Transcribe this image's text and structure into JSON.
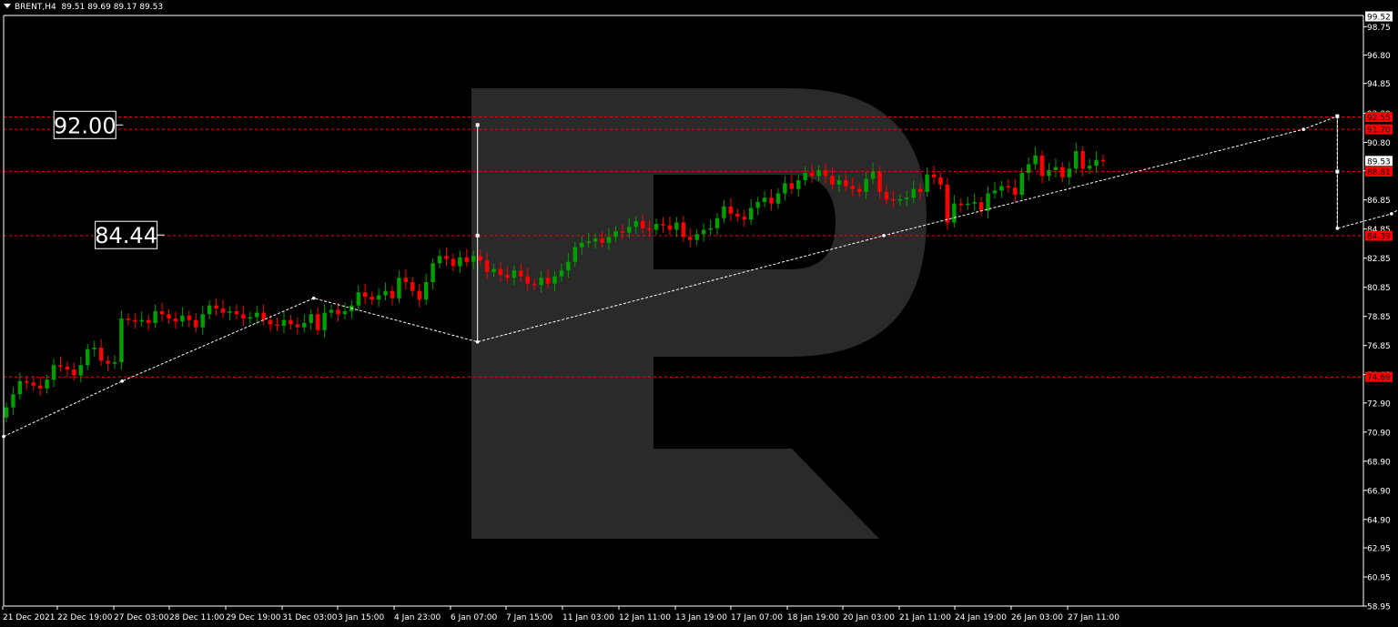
{
  "header": {
    "symbol": "BRENT,H4",
    "ohlc": "89.51 89.69 89.17 89.53"
  },
  "colors": {
    "background": "#000000",
    "bull": "#00a000",
    "bear": "#ff0000",
    "axis": "#ffffff",
    "level_line": "#ff0000",
    "forecast": "#ffffff",
    "watermark": "#2a2a2a"
  },
  "chart_data": {
    "type": "candlestick",
    "ylim": [
      58.95,
      99.52
    ],
    "y_ticks": [
      "98.75",
      "96.80",
      "94.85",
      "92.80",
      "90.80",
      "88.85",
      "86.85",
      "84.85",
      "82.85",
      "80.85",
      "78.85",
      "76.85",
      "74.85",
      "72.90",
      "70.90",
      "68.90",
      "66.90",
      "64.90",
      "62.95",
      "60.95",
      "58.95"
    ],
    "x_tick_labels": [
      "21 Dec 2021",
      "22 Dec 19:00",
      "27 Dec 03:00",
      "28 Dec 11:00",
      "29 Dec 19:00",
      "31 Dec 03:00",
      "3 Jan 15:00",
      "4 Jan 23:00",
      "6 Jan 07:00",
      "7 Jan 15:00",
      "11 Jan 03:00",
      "12 Jan 11:00",
      "13 Jan 19:00",
      "17 Jan 07:00",
      "18 Jan 19:00",
      "20 Jan 03:00",
      "21 Jan 11:00",
      "24 Jan 19:00",
      "26 Jan 03:00",
      "27 Jan 11:00"
    ],
    "current_price": "89.53",
    "top_price": "99.52",
    "levels": [
      {
        "label": "92.55",
        "value": 92.55
      },
      {
        "label": "91.70",
        "value": 91.7
      },
      {
        "label": "88.81",
        "value": 88.81
      },
      {
        "label": "84.39",
        "value": 84.39
      },
      {
        "label": "74.69",
        "value": 74.69
      }
    ],
    "annotations": [
      {
        "label": "92.00",
        "x": 4.2,
        "y": 92.0
      },
      {
        "label": "84.44",
        "x": 10.3,
        "y": 84.44
      }
    ],
    "candles": [
      [
        71.9,
        72.6
      ],
      [
        72.6,
        73.5
      ],
      [
        73.5,
        74.4
      ],
      [
        74.4,
        74.3
      ],
      [
        74.3,
        74.1
      ],
      [
        74.1,
        73.9
      ],
      [
        73.9,
        74.5
      ],
      [
        74.5,
        75.5
      ],
      [
        75.5,
        75.4
      ],
      [
        75.4,
        75.2
      ],
      [
        75.2,
        74.8
      ],
      [
        74.8,
        75.5
      ],
      [
        75.5,
        76.6
      ],
      [
        76.6,
        76.7
      ],
      [
        76.7,
        75.8
      ],
      [
        75.8,
        75.6
      ],
      [
        75.6,
        75.7
      ],
      [
        75.7,
        78.7
      ],
      [
        78.7,
        78.6
      ],
      [
        78.6,
        78.5
      ],
      [
        78.5,
        78.6
      ],
      [
        78.6,
        78.4
      ],
      [
        78.4,
        79.2
      ],
      [
        79.2,
        79.0
      ],
      [
        79.0,
        78.7
      ],
      [
        78.7,
        78.5
      ],
      [
        78.5,
        78.9
      ],
      [
        78.9,
        78.6
      ],
      [
        78.6,
        78.1
      ],
      [
        78.1,
        79.0
      ],
      [
        79.0,
        79.6
      ],
      [
        79.6,
        79.4
      ],
      [
        79.4,
        79.1
      ],
      [
        79.1,
        79.2
      ],
      [
        79.2,
        79.0
      ],
      [
        79.0,
        78.7
      ],
      [
        78.7,
        78.8
      ],
      [
        78.8,
        79.1
      ],
      [
        79.1,
        78.6
      ],
      [
        78.6,
        78.3
      ],
      [
        78.3,
        78.2
      ],
      [
        78.2,
        78.6
      ],
      [
        78.6,
        78.3
      ],
      [
        78.3,
        78.1
      ],
      [
        78.1,
        78.4
      ],
      [
        78.4,
        79.0
      ],
      [
        79.0,
        77.9
      ],
      [
        77.9,
        79.1
      ],
      [
        79.1,
        79.3
      ],
      [
        79.3,
        79.0
      ],
      [
        79.0,
        79.2
      ],
      [
        79.2,
        79.6
      ],
      [
        79.6,
        80.5
      ],
      [
        80.5,
        80.2
      ],
      [
        80.2,
        80.0
      ],
      [
        80.0,
        80.3
      ],
      [
        80.3,
        80.6
      ],
      [
        80.6,
        80.1
      ],
      [
        80.1,
        81.5
      ],
      [
        81.5,
        81.2
      ],
      [
        81.2,
        80.6
      ],
      [
        80.6,
        80.0
      ],
      [
        80.0,
        81.2
      ],
      [
        81.2,
        82.5
      ],
      [
        82.5,
        83.0
      ],
      [
        83.0,
        82.8
      ],
      [
        82.8,
        82.3
      ],
      [
        82.3,
        82.9
      ],
      [
        82.9,
        82.6
      ],
      [
        82.6,
        83.0
      ],
      [
        83.0,
        82.7
      ],
      [
        82.7,
        81.9
      ],
      [
        81.9,
        82.1
      ],
      [
        82.1,
        81.7
      ],
      [
        81.7,
        81.5
      ],
      [
        81.5,
        82.0
      ],
      [
        82.0,
        81.6
      ],
      [
        81.6,
        81.1
      ],
      [
        81.1,
        81.0
      ],
      [
        81.0,
        81.5
      ],
      [
        81.5,
        81.1
      ],
      [
        81.1,
        81.6
      ],
      [
        81.6,
        82.0
      ],
      [
        82.0,
        82.6
      ],
      [
        82.6,
        83.6
      ],
      [
        83.6,
        83.9
      ],
      [
        83.9,
        84.0
      ],
      [
        84.0,
        84.2
      ],
      [
        84.2,
        83.9
      ],
      [
        83.9,
        84.3
      ],
      [
        84.3,
        84.7
      ],
      [
        84.7,
        84.6
      ],
      [
        84.6,
        85.0
      ],
      [
        85.0,
        85.4
      ],
      [
        85.4,
        84.9
      ],
      [
        84.9,
        84.8
      ],
      [
        84.8,
        85.2
      ],
      [
        85.2,
        85.1
      ],
      [
        85.1,
        84.8
      ],
      [
        84.8,
        85.3
      ],
      [
        85.3,
        84.3
      ],
      [
        84.3,
        84.1
      ],
      [
        84.1,
        84.5
      ],
      [
        84.5,
        84.8
      ],
      [
        84.8,
        84.9
      ],
      [
        84.9,
        85.6
      ],
      [
        85.6,
        86.4
      ],
      [
        86.4,
        85.9
      ],
      [
        85.9,
        85.7
      ],
      [
        85.7,
        85.5
      ],
      [
        85.5,
        86.3
      ],
      [
        86.3,
        86.7
      ],
      [
        86.7,
        87.0
      ],
      [
        87.0,
        86.6
      ],
      [
        86.6,
        87.3
      ],
      [
        87.3,
        88.0
      ],
      [
        88.0,
        87.6
      ],
      [
        87.6,
        88.2
      ],
      [
        88.2,
        88.7
      ],
      [
        88.7,
        88.5
      ],
      [
        88.5,
        88.9
      ],
      [
        88.9,
        88.5
      ],
      [
        88.5,
        87.9
      ],
      [
        87.9,
        88.2
      ],
      [
        88.2,
        87.8
      ],
      [
        87.8,
        87.6
      ],
      [
        87.6,
        87.4
      ],
      [
        87.4,
        88.3
      ],
      [
        88.3,
        88.8
      ],
      [
        88.8,
        87.4
      ],
      [
        87.4,
        86.9
      ],
      [
        86.9,
        86.8
      ],
      [
        86.8,
        86.9
      ],
      [
        86.9,
        87.0
      ],
      [
        87.0,
        87.6
      ],
      [
        87.6,
        87.4
      ],
      [
        87.4,
        88.6
      ],
      [
        88.6,
        88.4
      ],
      [
        88.4,
        87.9
      ],
      [
        87.9,
        85.3
      ],
      [
        85.3,
        86.6
      ],
      [
        86.6,
        86.5
      ],
      [
        86.5,
        86.6
      ],
      [
        86.6,
        86.7
      ],
      [
        86.7,
        86.1
      ],
      [
        86.1,
        87.3
      ],
      [
        87.3,
        87.5
      ],
      [
        87.5,
        87.8
      ],
      [
        87.8,
        87.7
      ],
      [
        87.7,
        87.2
      ],
      [
        87.2,
        88.7
      ],
      [
        88.7,
        89.3
      ],
      [
        89.3,
        89.9
      ],
      [
        89.9,
        88.5
      ],
      [
        88.5,
        88.9
      ],
      [
        88.9,
        89.1
      ],
      [
        89.1,
        88.4
      ],
      [
        88.4,
        89.0
      ],
      [
        89.0,
        90.2
      ],
      [
        90.2,
        89.0
      ],
      [
        89.0,
        89.2
      ],
      [
        89.2,
        89.6
      ],
      [
        89.6,
        89.5
      ]
    ],
    "forecast_path": [
      [
        0.0,
        70.6
      ],
      [
        17.5,
        74.4
      ],
      [
        45.8,
        80.1
      ],
      [
        70.0,
        77.1
      ],
      [
        130.0,
        84.4
      ],
      [
        192.0,
        91.7
      ],
      [
        197.0,
        92.6
      ],
      [
        197.0,
        84.9
      ],
      [
        205.0,
        85.9
      ],
      [
        222.0,
        90.4
      ],
      [
        227.0,
        91.8
      ],
      [
        229.0,
        91.4
      ],
      [
        234.0,
        88.8
      ],
      [
        242.0,
        91.3
      ],
      [
        245.0,
        92.5
      ],
      [
        248.0,
        88.5
      ],
      [
        250.0,
        84.2
      ]
    ],
    "vertical_marker": {
      "x": 70.0,
      "y_from": 77.1,
      "y_to": 92.0,
      "mid": 84.4
    },
    "wedge_marker": {
      "x": 197.0,
      "y_from": 84.9,
      "y_to": 92.6,
      "mid": 88.8
    }
  }
}
